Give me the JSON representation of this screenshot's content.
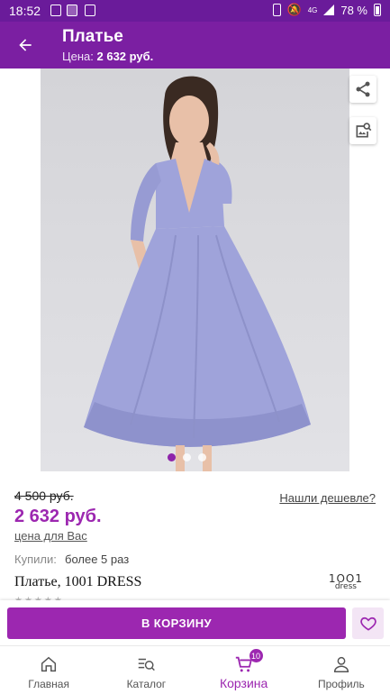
{
  "status_bar": {
    "time": "18:52",
    "network": "4G",
    "battery": "78 %"
  },
  "app_bar": {
    "title": "Платье",
    "subtitle_label": "Цена:",
    "subtitle_value": "2 632 руб."
  },
  "gallery": {
    "photo_alt": "dress-photo",
    "pages": 3,
    "active_page": 1
  },
  "product": {
    "old_price": "4 500 руб.",
    "found_cheaper": "Нашли дешевле?",
    "price": "2 632 руб.",
    "price_note": "цена для Вас",
    "bought_label": "Купили:",
    "bought_value": "более 5 раз",
    "name": "Платье, 1001 DRESS",
    "brand_logo": {
      "line1": "1OO1",
      "line2": "dress"
    }
  },
  "cart": {
    "add_label": "В КОРЗИНУ"
  },
  "bottom_nav": {
    "items": [
      {
        "label": "Главная",
        "icon": "home-icon"
      },
      {
        "label": "Каталог",
        "icon": "catalog-search-icon"
      },
      {
        "label": "Корзина",
        "icon": "cart-icon",
        "badge": "10",
        "active": true
      },
      {
        "label": "Профиль",
        "icon": "profile-icon"
      }
    ]
  },
  "colors": {
    "status_bar": "#6a1b9a",
    "app_bar": "#7b1fa2",
    "accent": "#9c27b0",
    "dress": "#9fa3da"
  }
}
